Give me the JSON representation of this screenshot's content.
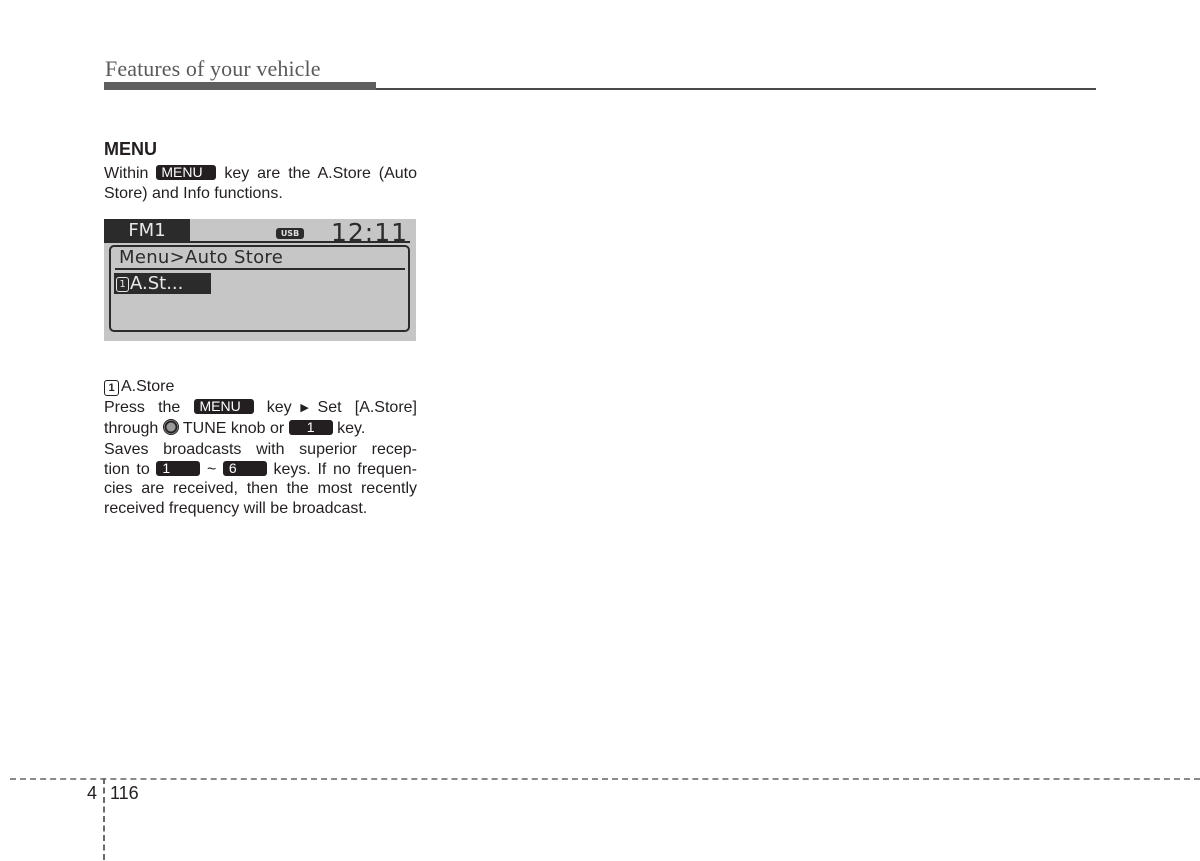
{
  "header": {
    "title": "Features of your vehicle"
  },
  "section": {
    "title": "MENU",
    "intro_before": "Within",
    "intro_key": "MENU",
    "intro_after_line1": "key are the A.Store (Auto",
    "intro_line2": "Store) and Info functions."
  },
  "display": {
    "band": "FM1",
    "usb_badge": "USB",
    "clock": "12:11",
    "path": "Menu>Auto Store",
    "item_number": "1",
    "item_label": "A.St..."
  },
  "item": {
    "number": "1",
    "title": "A.Store",
    "p1": {
      "press": "Press the",
      "key": "MENU",
      "key_word": "key",
      "set": "Set [A.Store]",
      "through": "through",
      "tune": "TUNE knob or",
      "num_key": "1",
      "end": "key."
    },
    "p2": {
      "line1": "Saves broadcasts with superior recep-",
      "tion_to": "tion to",
      "key_from": "1",
      "tilde": "~",
      "key_to": "6",
      "after_keys": "keys. If no frequen-",
      "line3": "cies are received, then the most recently",
      "line4": "received frequency will be broadcast."
    }
  },
  "footer": {
    "chapter": "4",
    "page": "116"
  }
}
